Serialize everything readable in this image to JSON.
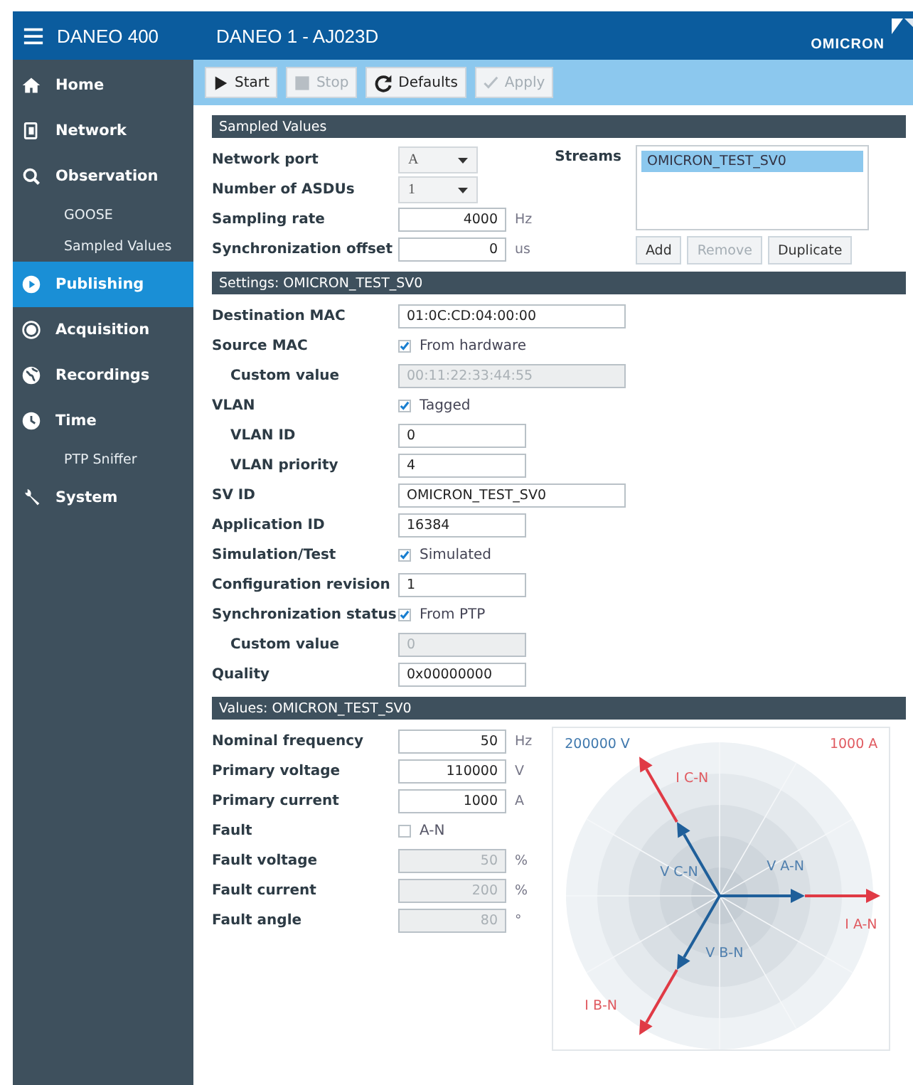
{
  "header": {
    "app_title": "DANEO 400",
    "device": "DANEO 1 - AJ023D",
    "brand": "OMICRON"
  },
  "sidebar": {
    "items": [
      {
        "label": "Home",
        "selected": false
      },
      {
        "label": "Network",
        "selected": false
      },
      {
        "label": "Observation",
        "selected": false,
        "children": [
          {
            "label": "GOOSE",
            "selected": false
          },
          {
            "label": "Sampled Values",
            "selected": false
          }
        ]
      },
      {
        "label": "Publishing",
        "selected": true
      },
      {
        "label": "Acquisition",
        "selected": false
      },
      {
        "label": "Recordings",
        "selected": false
      },
      {
        "label": "Time",
        "selected": false,
        "children": [
          {
            "label": "PTP Sniffer",
            "selected": false
          }
        ]
      },
      {
        "label": "System",
        "selected": false
      }
    ]
  },
  "toolbar": [
    {
      "label": "Start",
      "disabled": false
    },
    {
      "label": "Stop",
      "disabled": true
    },
    {
      "label": "Defaults",
      "disabled": false
    },
    {
      "label": "Apply",
      "disabled": true
    }
  ],
  "sections": [
    {
      "title": "Sampled Values",
      "kind": "streams",
      "rows": [
        {
          "label": "Network port",
          "kind": "select",
          "value": "A"
        },
        {
          "label": "Number of ASDUs",
          "kind": "select",
          "value": "1"
        },
        {
          "label": "Sampling rate",
          "kind": "number",
          "value": "4000",
          "unit": "Hz",
          "disabled": false
        },
        {
          "label": "Synchronization offset",
          "kind": "number",
          "value": "0",
          "unit": "us",
          "disabled": false
        }
      ],
      "streams": {
        "label": "Streams",
        "items": [
          {
            "text": "OMICRON_TEST_SV0",
            "selected": true
          }
        ],
        "buttons": [
          {
            "label": "Add",
            "disabled": false
          },
          {
            "label": "Remove",
            "disabled": true
          },
          {
            "label": "Duplicate",
            "disabled": false
          }
        ]
      }
    },
    {
      "title": "Settings: OMICRON_TEST_SV0",
      "kind": "form",
      "rows": [
        {
          "label": "Destination MAC",
          "kind": "wide",
          "value": "01:0C:CD:04:00:00",
          "disabled": false
        },
        {
          "label": "Source MAC",
          "kind": "check",
          "value": "From hardware",
          "checked": true,
          "children": [
            {
              "label": "Custom value",
              "kind": "wide",
              "value": "00:11:22:33:44:55",
              "disabled": true
            }
          ]
        },
        {
          "label": "VLAN",
          "kind": "check",
          "value": "Tagged",
          "checked": true,
          "children": [
            {
              "label": "VLAN ID",
              "kind": "text",
              "value": "0",
              "disabled": false
            },
            {
              "label": "VLAN priority",
              "kind": "text",
              "value": "4",
              "disabled": false
            }
          ]
        },
        {
          "label": "SV ID",
          "kind": "wide",
          "value": "OMICRON_TEST_SV0",
          "disabled": false
        },
        {
          "label": "Application ID",
          "kind": "text",
          "value": "16384",
          "disabled": false
        },
        {
          "label": "Simulation/Test",
          "kind": "check",
          "value": "Simulated",
          "checked": true
        },
        {
          "label": "Configuration revision",
          "kind": "text",
          "value": "1",
          "disabled": false
        },
        {
          "label": "Synchronization status",
          "kind": "check",
          "value": "From PTP",
          "checked": true,
          "children": [
            {
              "label": "Custom value",
              "kind": "text",
              "value": "0",
              "disabled": true
            }
          ]
        },
        {
          "label": "Quality",
          "kind": "text",
          "value": "0x00000000",
          "disabled": false
        }
      ]
    },
    {
      "title": "Values: OMICRON_TEST_SV0",
      "kind": "phasor",
      "rows": [
        {
          "label": "Nominal frequency",
          "kind": "number",
          "value": "50",
          "unit": "Hz",
          "disabled": false
        },
        {
          "label": "Primary voltage",
          "kind": "number",
          "value": "110000",
          "unit": "V",
          "disabled": false
        },
        {
          "label": "Primary current",
          "kind": "number",
          "value": "1000",
          "unit": "A",
          "disabled": false
        },
        {
          "label": "Fault",
          "kind": "check",
          "value": "A-N",
          "checked": false
        },
        {
          "label": "Fault voltage",
          "kind": "number",
          "value": "50",
          "unit": "%",
          "disabled": true
        },
        {
          "label": "Fault current",
          "kind": "number",
          "value": "200",
          "unit": "%",
          "disabled": true
        },
        {
          "label": "Fault angle",
          "kind": "number",
          "value": "80",
          "unit": "°",
          "disabled": true
        }
      ],
      "phasor": {
        "voltage_scale": "200000 V",
        "current_scale": "1000 A",
        "vectors": [
          {
            "label": "V A-N",
            "kind": "voltage"
          },
          {
            "label": "V B-N",
            "kind": "voltage"
          },
          {
            "label": "V C-N",
            "kind": "voltage"
          },
          {
            "label": "I A-N",
            "kind": "current"
          },
          {
            "label": "I B-N",
            "kind": "current"
          },
          {
            "label": "I C-N",
            "kind": "current"
          }
        ]
      }
    }
  ]
}
